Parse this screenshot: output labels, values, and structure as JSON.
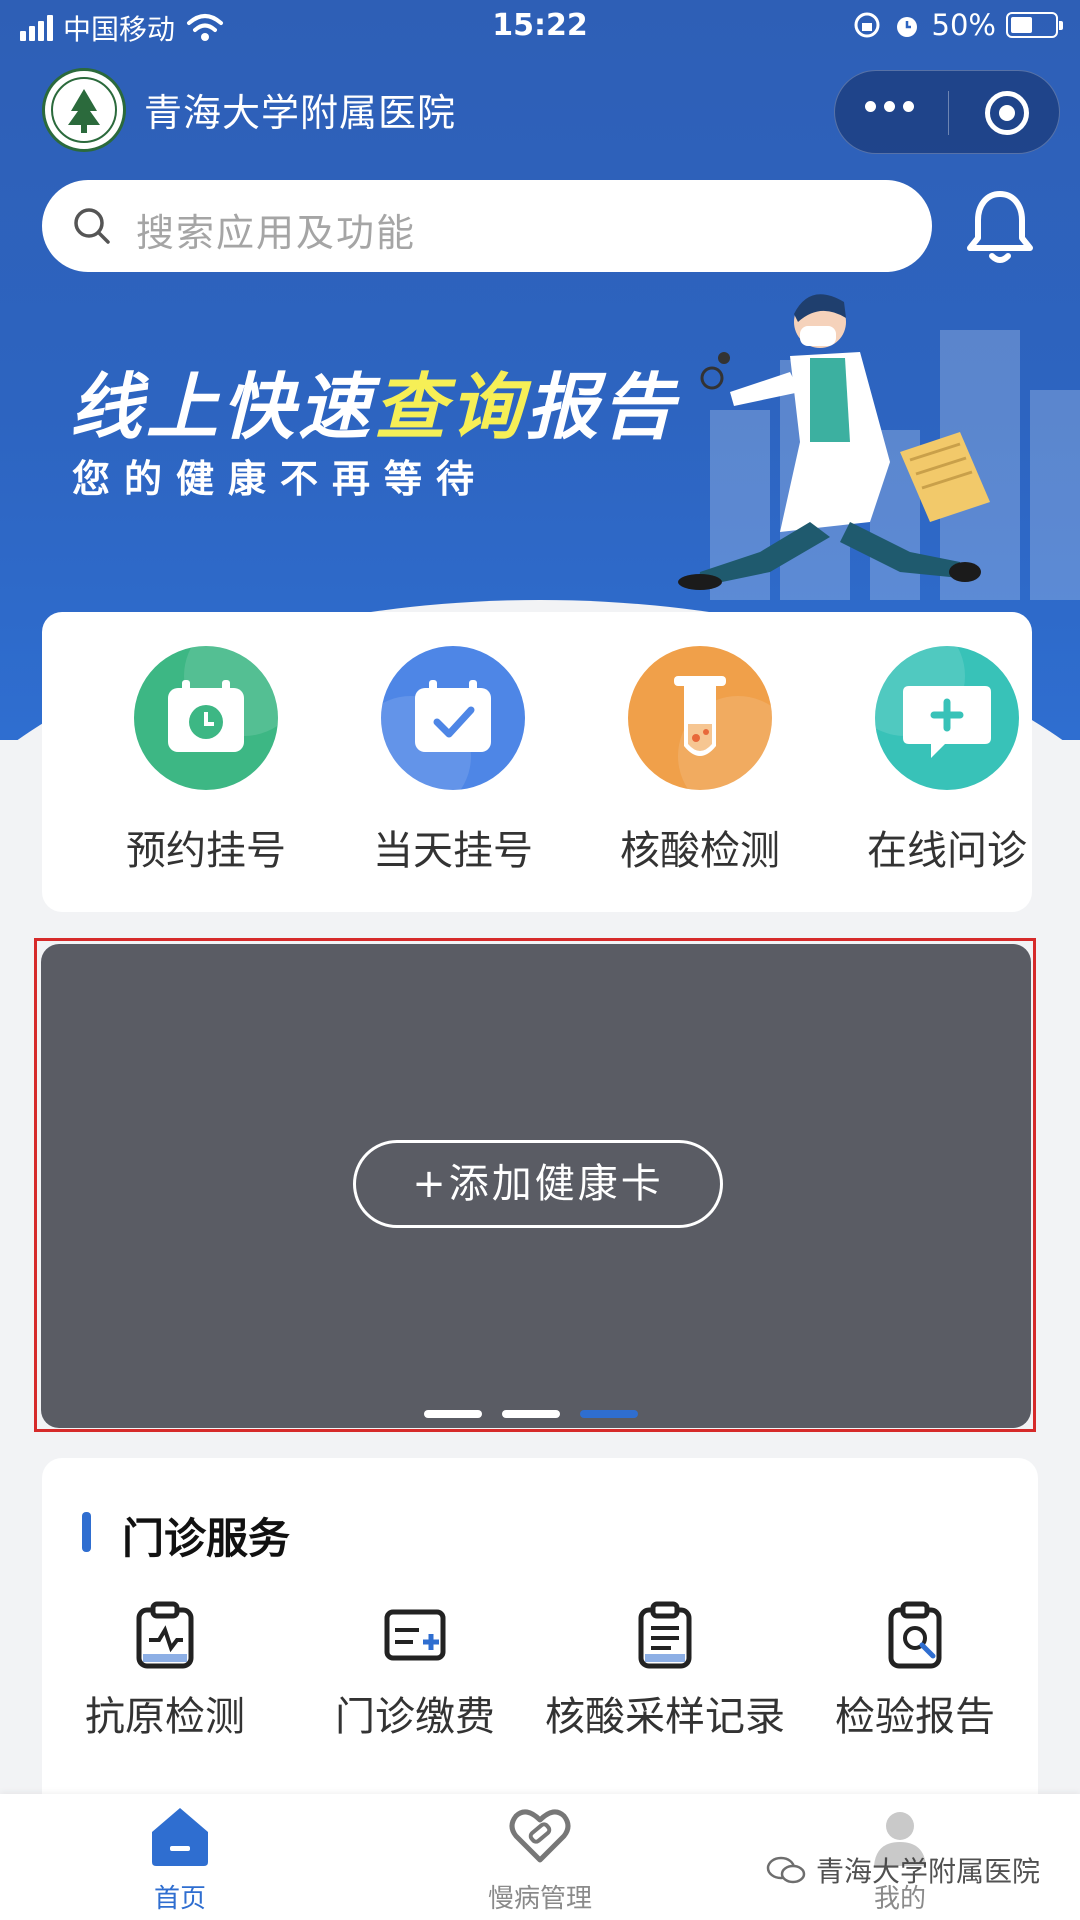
{
  "status_bar": {
    "carrier": "中国移动",
    "time": "15:22",
    "battery": "50%",
    "battery_level": 0.5
  },
  "navbar": {
    "hospital_name": "青海大学附属医院"
  },
  "search": {
    "placeholder": "搜索应用及功能"
  },
  "banner": {
    "title_part1": "线上快速",
    "title_highlight": "查询",
    "title_part2": "报告",
    "subtitle": "您的健康不再等待"
  },
  "quick_services": [
    {
      "label": "预约挂号",
      "icon": "clock-calendar-icon",
      "color": "#3db784"
    },
    {
      "label": "当天挂号",
      "icon": "check-calendar-icon",
      "color": "#4e86e6"
    },
    {
      "label": "核酸检测",
      "icon": "test-tube-icon",
      "color": "#f0a04a"
    },
    {
      "label": "在线问诊",
      "icon": "chat-plus-icon",
      "color": "#38c2b8"
    }
  ],
  "health_card": {
    "add_label": "+添加健康卡",
    "carousel_total": 3,
    "carousel_active": 3
  },
  "outpatient": {
    "title": "门诊服务",
    "items": [
      {
        "label": "抗原检测",
        "icon": "clipboard-chart-icon"
      },
      {
        "label": "门诊缴费",
        "icon": "bill-plus-icon"
      },
      {
        "label": "核酸采样记录",
        "icon": "clipboard-list-icon"
      },
      {
        "label": "检验报告",
        "icon": "report-search-icon"
      }
    ]
  },
  "tabbar": {
    "items": [
      {
        "label": "首页",
        "icon": "home-icon",
        "active": true
      },
      {
        "label": "慢病管理",
        "icon": "heart-bandage-icon",
        "active": false
      },
      {
        "label": "我的",
        "icon": "user-icon",
        "active": false
      }
    ]
  },
  "watermark": {
    "text": "青海大学附属医院"
  },
  "colors": {
    "primary": "#2f6ed0",
    "header_bg": "#2d64c0",
    "card_bg": "#5a5c64"
  }
}
